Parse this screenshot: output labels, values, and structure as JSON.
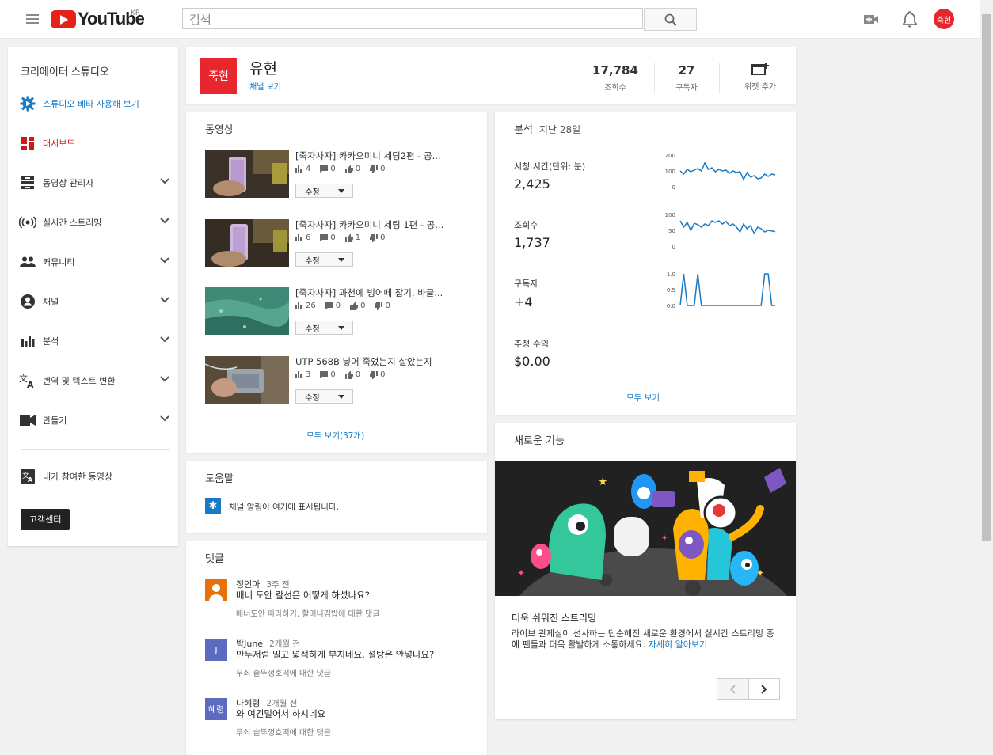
{
  "header": {
    "logo_text": "YouTube",
    "region": "KR",
    "search_placeholder": "검색",
    "avatar_text": "죽현"
  },
  "sidebar": {
    "title": "크리에이터 스튜디오",
    "items": [
      {
        "label": "스튜디오 베타 사용해 보기",
        "icon": "gear-icon",
        "color": "#167ac6"
      },
      {
        "label": "대시보드",
        "icon": "dashboard-icon",
        "color": "#cc181e"
      },
      {
        "label": "동영상 관리자",
        "icon": "video-manager-icon"
      },
      {
        "label": "실시간 스트리밍",
        "icon": "live-icon"
      },
      {
        "label": "커뮤니티",
        "icon": "community-icon"
      },
      {
        "label": "채널",
        "icon": "channel-icon"
      },
      {
        "label": "분석",
        "icon": "analytics-icon"
      },
      {
        "label": "번역 및 텍스트 변환",
        "icon": "translate-icon"
      },
      {
        "label": "만들기",
        "icon": "create-icon"
      }
    ],
    "contributed_label": "내가 참여한 동영상",
    "help_button": "고객센터"
  },
  "channel": {
    "avatar_text": "죽현",
    "name": "유현",
    "view_channel": "채널 보기",
    "views_value": "17,784",
    "views_label": "조회수",
    "subs_value": "27",
    "subs_label": "구독자",
    "widget_label": "위젯 추가"
  },
  "videos": {
    "title": "동영상",
    "edit_label": "수정",
    "items": [
      {
        "title": "[죽자사자] 카카오미니 세팅2편 - 공...",
        "views": "4",
        "comments": "0",
        "likes": "0",
        "dislikes": "0"
      },
      {
        "title": "[죽자사자] 카카오미니 세팅 1편 - 공...",
        "views": "6",
        "comments": "0",
        "likes": "1",
        "dislikes": "0"
      },
      {
        "title": "[죽자사자] 과천에 빙어떼 잡기, 바글...",
        "views": "26",
        "comments": "0",
        "likes": "0",
        "dislikes": "0"
      },
      {
        "title": "UTP 568B 넣어 죽었는지 살았는지",
        "views": "3",
        "comments": "0",
        "likes": "0",
        "dislikes": "0"
      }
    ],
    "see_all": "모두 보기(37개)"
  },
  "help": {
    "title": "도움말",
    "tip": "채널 알림이 여기에 표시됩니다."
  },
  "comments": {
    "title": "댓글",
    "items": [
      {
        "avatar": "",
        "avatar_color": "#e8710a",
        "name": "정인아",
        "time": "3주 전",
        "text": "배너 도안 칼선은 어떻게 하셨나요?",
        "ref": "배너도안 따라하기, 할머니김밥에 대한 댓글"
      },
      {
        "avatar": "J",
        "avatar_color": "#5c6bc0",
        "name": "박June",
        "time": "2개월 전",
        "text": "만두저럼 밀고 넓적하게 부치네요. 설탕은 안넣나요?",
        "ref": "무쇠 솥뚜껑호떡에 대한 댓글"
      },
      {
        "avatar": "혜령",
        "avatar_color": "#5c6bc0",
        "name": "나혜령",
        "time": "2개월 전",
        "text": "와 여긴밀어서 하시네요",
        "ref": "무쇠 솥뚜껑호떡에 대한 댓글"
      }
    ]
  },
  "analytics": {
    "title": "분석",
    "period": "지난 28일",
    "metrics": [
      {
        "label": "시청 시간(단위: 분)",
        "value": "2,425",
        "ticks": [
          "200",
          "100",
          "0"
        ],
        "ymax": 200,
        "series": [
          100,
          80,
          110,
          95,
          105,
          115,
          100,
          150,
          110,
          120,
          95,
          110,
          100,
          105,
          85,
          100,
          90,
          95,
          45,
          90,
          60,
          70,
          50,
          55,
          80,
          65,
          80,
          75
        ]
      },
      {
        "label": "조회수",
        "value": "1,737",
        "ticks": [
          "100",
          "50",
          "0"
        ],
        "ymax": 100,
        "series": [
          80,
          60,
          75,
          50,
          72,
          68,
          60,
          70,
          65,
          80,
          75,
          80,
          70,
          78,
          65,
          70,
          60,
          45,
          70,
          55,
          65,
          40,
          60,
          55,
          45,
          50,
          48,
          46
        ]
      },
      {
        "label": "구독자",
        "value": "+4",
        "ticks": [
          "1.0",
          "0.5",
          "0.0"
        ],
        "ymax": 1,
        "series": [
          0,
          1,
          0,
          0,
          0,
          1,
          0,
          0,
          0,
          0,
          0,
          0,
          0,
          0,
          0,
          0,
          0,
          0,
          0,
          0,
          0,
          0,
          0,
          0,
          1,
          1,
          0,
          0
        ]
      },
      {
        "label": "추정 수익",
        "value": "$0.00"
      }
    ],
    "see_all": "모두 보기",
    "line_color": "#167ac6"
  },
  "new_features": {
    "title": "새로운 기능",
    "feature_title": "더욱 쉬워진 스트리밍",
    "feature_text": "라이브 관제실이 선사하는 단순해진 새로운 환경에서 실시간 스트리밍 중에 팬들과 더욱 활발하게 소통하세요.",
    "learn_more": "자세히 알아보기"
  }
}
